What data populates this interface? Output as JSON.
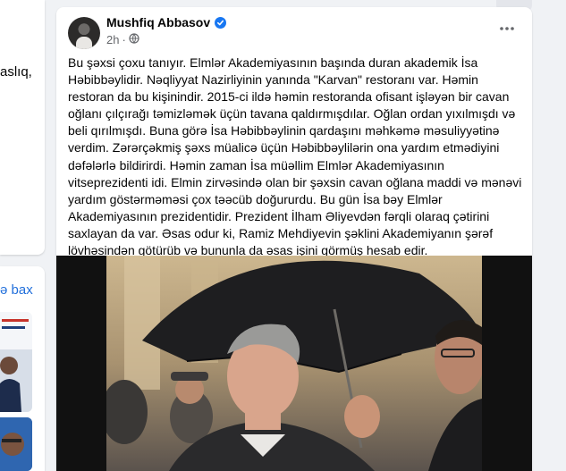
{
  "left_column": {
    "fragment_1": "aslıq,",
    "see_all_fragment": "ə bax"
  },
  "post": {
    "author": "Mushfiq Abbasov",
    "time": "2h",
    "body": "Bu şəxsi çoxu tanıyır. Elmlər Akademiyasının başında duran akademik İsa Həbibbəylidir. Nəqliyyat Nazirliyinin yanında \"Karvan\" restoranı var. Həmin restoran da bu kişinindir. 2015-ci ildə həmin restoranda ofisant işləyən bir cavan oğlanı çılçırağı təmizləmək üçün tavana qaldırmışdılar. Oğlan ordan yıxılmışdı və beli qırılmışdı. Buna görə İsa Həbibbəylinin qardaşını məhkəmə məsuliyyətinə verdim. Zərərçəkmiş şəxs müalicə üçün Həbibbəylilərin ona yardım etmədiyini dəfələrlə bildirirdi. Həmin zaman İsa müəllim Elmlər Akademiyasının vitseprezidenti idi. Elmin zirvəsində olan bir şəxsin cavan oğlana maddi və mənəvi yardım göstərməməsi çox təəcüb doğururdu. Bu gün İsa bəy Elmlər Akademiyasının prezidentidir. Prezident İlham Əliyevdən fərqli olaraq çətirini saxlayan da var. Əsas odur ki, Ramiz Mehdiyevin şəklini Akademiyanın şərəf lövhəsindən götürüb və bununla da əsas işini görmüş hesab edir. Elm+vəzifə=Azərbaycan məmuru"
  },
  "icons": {
    "verified": "verified-badge-icon",
    "audience": "globe-icon",
    "more": "more-options-icon"
  },
  "colors": {
    "link": "#216fdb",
    "verified": "#1877f2",
    "secondary_text": "#65676b"
  }
}
